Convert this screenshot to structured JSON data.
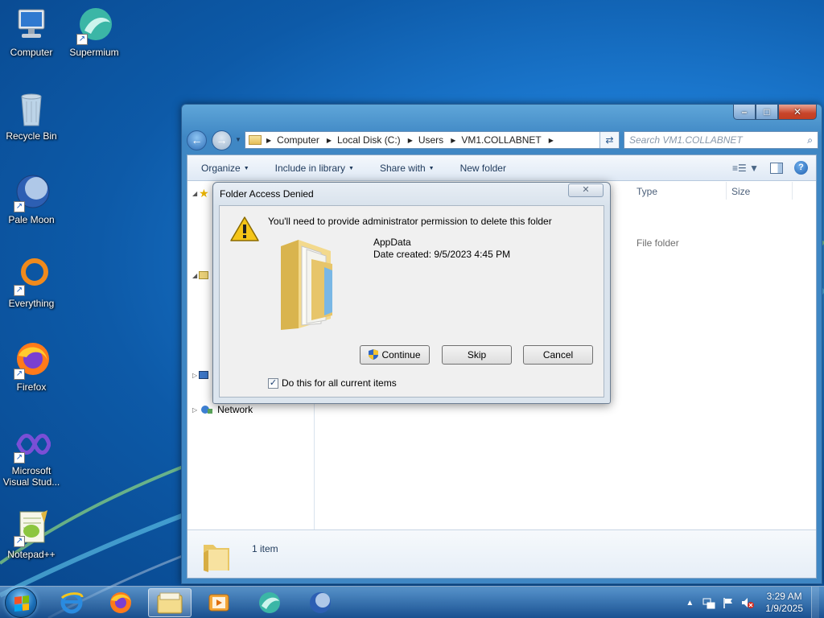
{
  "desktop": {
    "icons": [
      {
        "label": "Computer"
      },
      {
        "label": "Supermium"
      },
      {
        "label": "Recycle Bin"
      },
      {
        "label": "Pale Moon"
      },
      {
        "label": "Everything"
      },
      {
        "label": "Firefox"
      },
      {
        "label": "Microsoft Visual Stud..."
      },
      {
        "label": "Notepad++"
      }
    ]
  },
  "explorer": {
    "breadcrumbs": [
      "Computer",
      "Local Disk (C:)",
      "Users",
      "VM1.COLLABNET"
    ],
    "search_placeholder": "Search VM1.COLLABNET",
    "toolbar": {
      "organize": "Organize",
      "include_in_library": "Include in library",
      "share_with": "Share with",
      "new_folder": "New folder"
    },
    "columns": {
      "type": "Type",
      "size": "Size"
    },
    "row_type": "File folder",
    "nav": {
      "network": "Network"
    },
    "details": {
      "count": "1 item"
    }
  },
  "dialog": {
    "title": "Folder Access Denied",
    "message": "You'll need to provide administrator permission to delete this folder",
    "file_name": "AppData",
    "date_created": "Date created: 9/5/2023 4:45 PM",
    "buttons": {
      "continue": "Continue",
      "skip": "Skip",
      "cancel": "Cancel"
    },
    "checkbox_label": "Do this for all current items",
    "checkbox_checked": true
  },
  "taskbar": {
    "clock_time": "3:29 AM",
    "clock_date": "1/9/2025"
  },
  "colors": {
    "desktop": "#1b78cf",
    "window_frame": "#3f87c4",
    "close_button": "#c8442a"
  }
}
